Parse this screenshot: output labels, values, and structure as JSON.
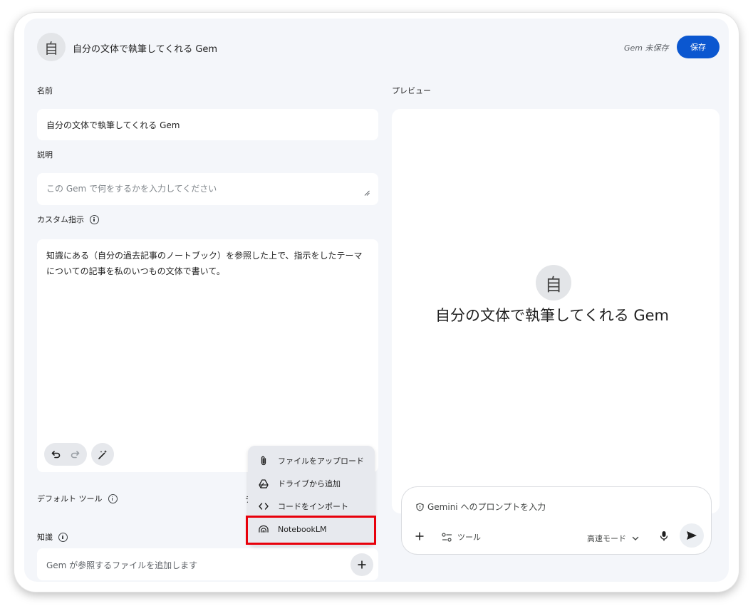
{
  "header": {
    "avatar_letter": "自",
    "title": "自分の文体で執筆してくれる Gem",
    "unsaved_status": "Gem 未保存",
    "save_label": "保存"
  },
  "form": {
    "name_label": "名前",
    "name_value": "自分の文体で執筆してくれる Gem",
    "description_label": "説明",
    "description_placeholder": "この Gem で何をするかを入力してください",
    "instructions_label": "カスタム指示",
    "instructions_value": "知識にある（自分の過去記事のノートブック）を参照した上で、指示をしたテーマについての記事を私のいつもの文体で書いて。",
    "default_tools_label": "デフォルト ツール",
    "default_tools_partial": "テ",
    "knowledge_label": "知識",
    "knowledge_placeholder": "Gem が参照するファイルを追加します"
  },
  "upload_menu": {
    "items": [
      {
        "label": "ファイルをアップロード",
        "icon": "paperclip-icon"
      },
      {
        "label": "ドライブから追加",
        "icon": "drive-icon"
      },
      {
        "label": "コードをインポート",
        "icon": "code-icon"
      },
      {
        "label": "NotebookLM",
        "icon": "notebooklm-icon"
      }
    ],
    "highlight_color": "#e8000b"
  },
  "preview": {
    "label": "プレビュー",
    "avatar_letter": "自",
    "title": "自分の文体で執筆してくれる Gem",
    "prompt_placeholder": "Gemini へのプロンプトを入力",
    "tools_label": "ツール",
    "mode_label": "高速モード"
  },
  "colors": {
    "accent": "#0b57d0",
    "background": "#f4f6fa"
  }
}
